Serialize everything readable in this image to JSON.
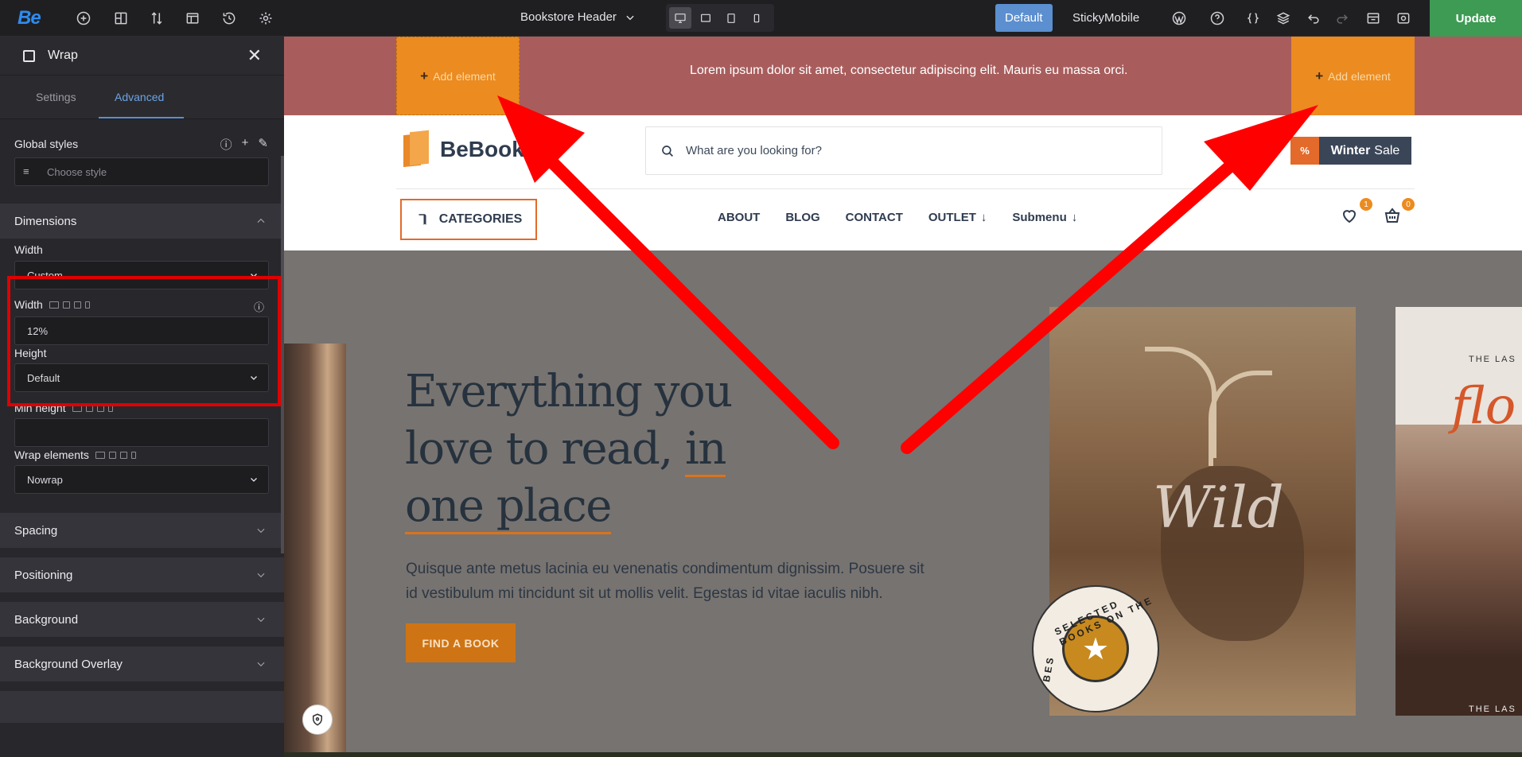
{
  "topbar": {
    "logo": "Be",
    "icons": [
      "plus-circle-icon",
      "add-section-icon",
      "sort-icon",
      "template-icon",
      "history-icon",
      "settings-icon"
    ],
    "title": "Bookstore Header",
    "devices": [
      "desktop-icon",
      "laptop-icon",
      "tablet-icon",
      "mobile-icon"
    ],
    "active_device": "desktop",
    "modes": [
      "Default",
      "Sticky",
      "Mobile"
    ],
    "active_mode": "Default",
    "right_icons": [
      "wordpress-icon",
      "help-icon",
      "code-icon",
      "layers-icon",
      "undo-icon",
      "redo-icon",
      "preview-layout-icon",
      "eye-icon"
    ],
    "update_label": "Update",
    "update_color": "#3d9b53"
  },
  "sidebar": {
    "title": "Wrap",
    "tabs": [
      "Settings",
      "Advanced"
    ],
    "active_tab": "Advanced",
    "global_styles": {
      "label": "Global styles",
      "placeholder": "Choose style"
    },
    "dimensions": {
      "label": "Dimensions",
      "width_mode_label": "Width",
      "width_mode_value": "Custom",
      "width_label": "Width",
      "width_value": "12%",
      "height_label": "Height",
      "height_value": "Default",
      "min_height_label": "Min height",
      "min_height_value": "",
      "wrap_label": "Wrap elements",
      "wrap_value": "Nowrap"
    },
    "sections": [
      "Spacing",
      "Positioning",
      "Background",
      "Background Overlay"
    ],
    "highlight_color": "#e00000"
  },
  "canvas": {
    "add_element_label": "Add element",
    "strip_text": "Lorem ipsum dolor sit amet, consectetur adipiscing elit. Mauris eu massa orci.",
    "strip_color": "#a85d5c",
    "wrap_color": "#ec8b1f",
    "logo_text": "BeBook",
    "search_placeholder": "What are you looking for?",
    "promo": {
      "percent": "%",
      "bold": "Winter",
      "rest": "Sale"
    },
    "categories_label": "CATEGORIES",
    "nav": [
      "ABOUT",
      "BLOG",
      "CONTACT",
      "OUTLET",
      "Submenu"
    ],
    "wishlist_count": "1",
    "cart_count": "0",
    "hero": {
      "line1": "Everything you",
      "line2a": "love to read, ",
      "line2b": "in",
      "line3": "one place",
      "subtitle": "Quisque ante metus lacinia eu venenatis condimentum dignissim. Posuere sit id vestibulum mi tincidunt sit ut mollis velit. Egestas id vitae iaculis nibh.",
      "button": "FIND A BOOK"
    },
    "book_deer_word": "Wild",
    "seal_text": "SELECTED BOOKS ON THE",
    "seal_prefix": "BES",
    "book_right_top": "THE LAS",
    "book_right_script": "flo",
    "book_right_bottom": "THE LAS"
  },
  "annotation": {
    "arrow_color": "#ff0000"
  }
}
